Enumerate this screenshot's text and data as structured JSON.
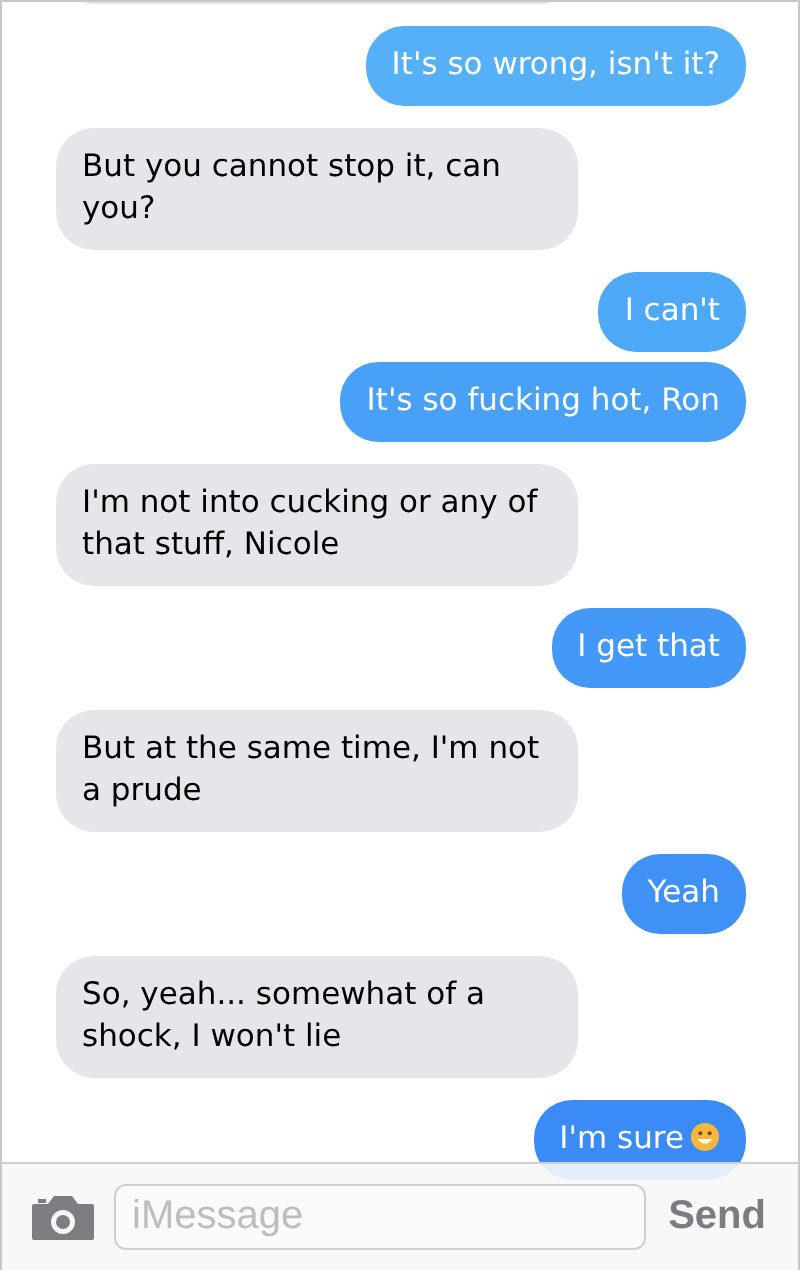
{
  "messages": [
    {
      "kind": "received"
    },
    {
      "kind": "sent",
      "text": "It's so wrong, isn't it?"
    },
    {
      "kind": "received",
      "text": "But you cannot stop it, can you?"
    },
    {
      "kind": "sent",
      "text": "I can't"
    },
    {
      "kind": "sent",
      "text": "It's so fucking hot, Ron"
    },
    {
      "kind": "received",
      "text": "I'm not into cucking or any of that stuff, Nicole"
    },
    {
      "kind": "sent",
      "text": "I get that"
    },
    {
      "kind": "received",
      "text": "But at the same time, I'm not a prude"
    },
    {
      "kind": "sent",
      "text": "Yeah"
    },
    {
      "kind": "received",
      "text": "So, yeah... somewhat of a shock, I won't lie"
    },
    {
      "kind": "sent",
      "text": "I'm sure",
      "emoji": true
    }
  ],
  "composer": {
    "placeholder": "iMessage",
    "send_label": "Send"
  }
}
